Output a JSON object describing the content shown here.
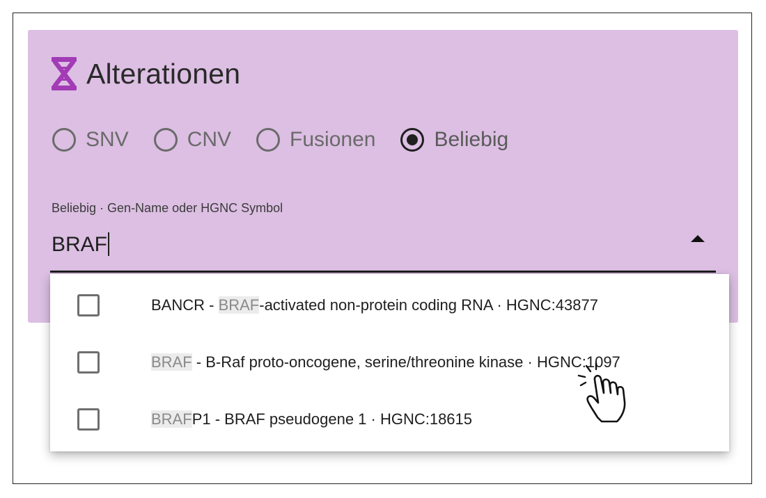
{
  "section": {
    "title": "Alterationen",
    "icon": "dna-icon",
    "accent_color": "#a23bb5",
    "panel_color": "#dcbfe3"
  },
  "radios": [
    {
      "label": "SNV",
      "checked": false
    },
    {
      "label": "CNV",
      "checked": false
    },
    {
      "label": "Fusionen",
      "checked": false
    },
    {
      "label": "Beliebig",
      "checked": true
    }
  ],
  "search": {
    "label": "Beliebig · Gen-Name oder HGNC Symbol",
    "value": "BRAF"
  },
  "options": [
    {
      "before": "BANCR - ",
      "match": "BRAF",
      "after": "-activated non-protein coding RNA · HGNC:43877",
      "checked": false
    },
    {
      "before": "",
      "match": "BRAF",
      "after": " - B-Raf proto-oncogene, serine/threonine kinase · HGNC:1097",
      "checked": false
    },
    {
      "before": "",
      "match": "BRAF",
      "after": "P1 - BRAF pseudogene 1 · HGNC:18615",
      "checked": false
    }
  ],
  "cursor": {
    "icon": "hand-pointer-icon"
  }
}
